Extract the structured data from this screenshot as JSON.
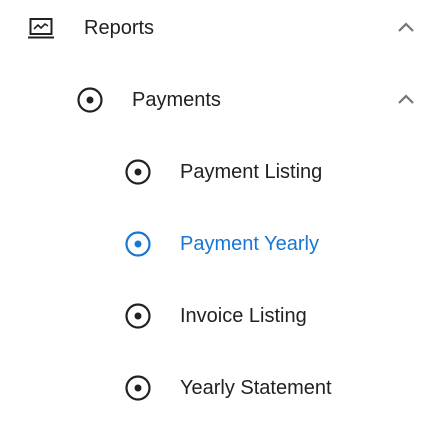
{
  "nav": {
    "reports": {
      "label": "Reports",
      "icon": "report-chart-icon",
      "expanded": true
    },
    "payments": {
      "label": "Payments",
      "icon": "radio-dot-icon",
      "expanded": true
    },
    "items": [
      {
        "label": "Payment Listing",
        "icon": "radio-dot-icon",
        "active": false
      },
      {
        "label": "Payment Yearly",
        "icon": "radio-dot-icon",
        "active": true
      },
      {
        "label": "Invoice Listing",
        "icon": "radio-dot-icon",
        "active": false
      },
      {
        "label": "Yearly Statement",
        "icon": "radio-dot-icon",
        "active": false
      }
    ]
  },
  "colors": {
    "text": "#212121",
    "icon": "#212121",
    "active": "#1976d2",
    "chevron": "#757575"
  }
}
